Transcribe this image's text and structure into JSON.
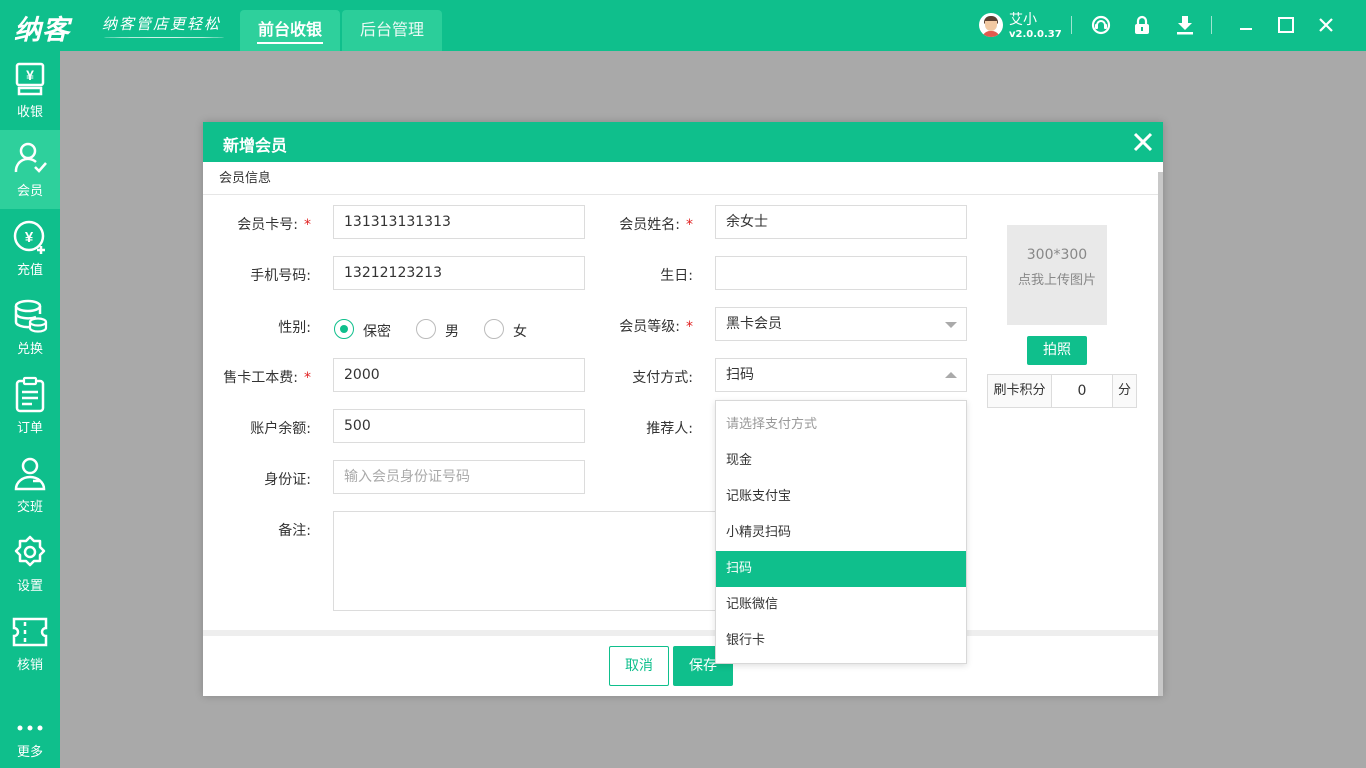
{
  "app": {
    "logo": "纳客",
    "slogan": "纳客管店更轻松",
    "tabs": [
      {
        "label": "前台收银",
        "active": true
      },
      {
        "label": "后台管理",
        "active": false
      }
    ],
    "user": {
      "name": "艾小",
      "version": "v2.0.0.37"
    },
    "icons": [
      "support-icon",
      "lock-icon",
      "download-icon",
      "minimize-icon",
      "maximize-icon",
      "close-icon"
    ]
  },
  "sidebar": {
    "items": [
      {
        "label": "收银",
        "icon": "cashier-icon"
      },
      {
        "label": "会员",
        "icon": "member-icon",
        "active": true
      },
      {
        "label": "充值",
        "icon": "recharge-icon"
      },
      {
        "label": "兑换",
        "icon": "exchange-icon"
      },
      {
        "label": "订单",
        "icon": "order-icon"
      },
      {
        "label": "交班",
        "icon": "shift-icon"
      },
      {
        "label": "设置",
        "icon": "settings-icon"
      },
      {
        "label": "核销",
        "icon": "verify-icon"
      },
      {
        "label": "更多",
        "icon": "more-icon"
      }
    ]
  },
  "modal": {
    "title": "新增会员",
    "section": "会员信息",
    "fields": {
      "card_no": {
        "label": "会员卡号:",
        "value": "131313131313",
        "required": true
      },
      "name": {
        "label": "会员姓名:",
        "value": "余女士",
        "required": true
      },
      "phone": {
        "label": "手机号码:",
        "value": "13212123213"
      },
      "birthday": {
        "label": "生日:",
        "value": ""
      },
      "gender": {
        "label": "性别:",
        "options": [
          "保密",
          "男",
          "女"
        ],
        "selected": "保密"
      },
      "level": {
        "label": "会员等级:",
        "value": "黑卡会员",
        "required": true
      },
      "card_fee": {
        "label": "售卡工本费:",
        "value": "2000",
        "required": true
      },
      "payment": {
        "label": "支付方式:",
        "value": "扫码"
      },
      "balance": {
        "label": "账户余额:",
        "value": "500"
      },
      "referrer": {
        "label": "推荐人:",
        "value": ""
      },
      "id_card": {
        "label": "身份证:",
        "placeholder": "输入会员身份证号码"
      },
      "remark": {
        "label": "备注:",
        "value": ""
      }
    },
    "photo": {
      "size": "300*300",
      "hint": "点我上传图片",
      "button": "拍照"
    },
    "points": {
      "label": "刷卡积分",
      "value": "0",
      "unit": "分"
    },
    "buttons": {
      "cancel": "取消",
      "save": "保存"
    },
    "payment_dropdown": {
      "placeholder": "请选择支付方式",
      "options": [
        "现金",
        "记账支付宝",
        "小精灵扫码",
        "扫码",
        "记账微信",
        "银行卡"
      ],
      "selected": "扫码"
    }
  }
}
